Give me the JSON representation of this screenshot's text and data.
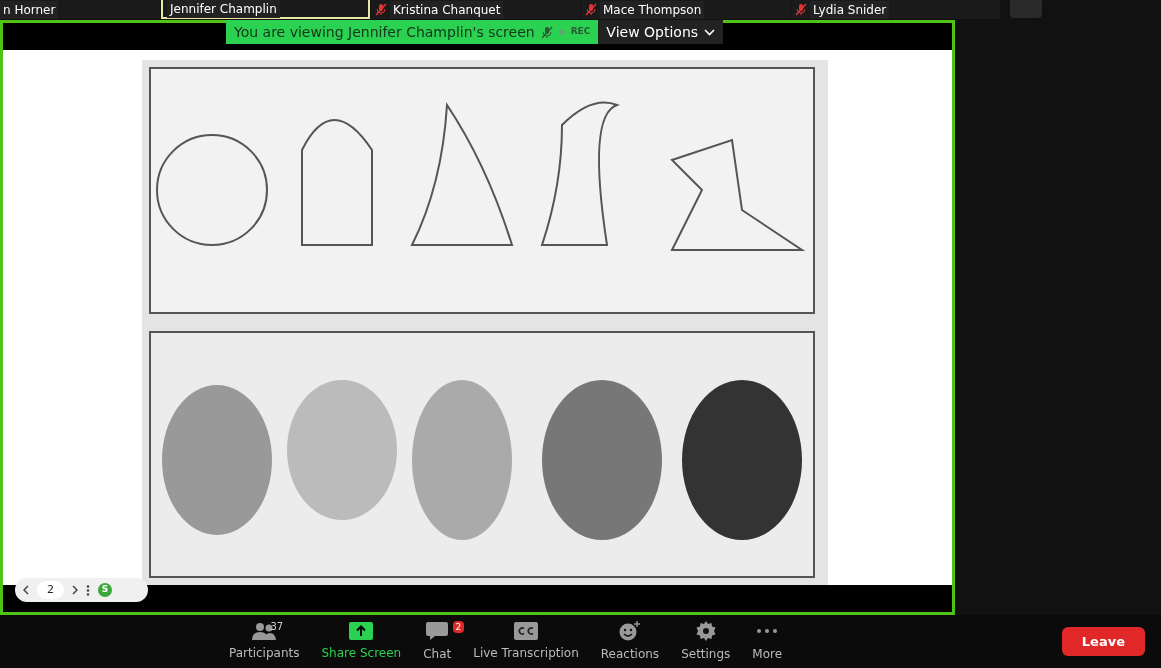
{
  "participants": [
    {
      "name": "n Horner",
      "muted": false,
      "speaking": false
    },
    {
      "name": "Jennifer Champlin",
      "muted": false,
      "speaking": true
    },
    {
      "name": "Kristina Chanquet",
      "muted": true,
      "speaking": false
    },
    {
      "name": "Mace Thompson",
      "muted": true,
      "speaking": false
    },
    {
      "name": "Lydia Snider",
      "muted": true,
      "speaking": false
    }
  ],
  "share": {
    "banner": "You are viewing Jennifer Champlin's screen",
    "muted": true,
    "recording": true,
    "rec_label": "REC",
    "view_options": "View Options"
  },
  "page_nav": {
    "page": "2",
    "avatar": "S"
  },
  "toolbar": [
    {
      "kind": "participants",
      "label": "Participants",
      "count": "37"
    },
    {
      "kind": "share",
      "label": "Share Screen"
    },
    {
      "kind": "chat",
      "label": "Chat",
      "badge": "2"
    },
    {
      "kind": "cc",
      "label": "Live Transcription"
    },
    {
      "kind": "reactions",
      "label": "Reactions"
    },
    {
      "kind": "settings",
      "label": "Settings"
    },
    {
      "kind": "more",
      "label": "More"
    }
  ],
  "leave": "Leave"
}
